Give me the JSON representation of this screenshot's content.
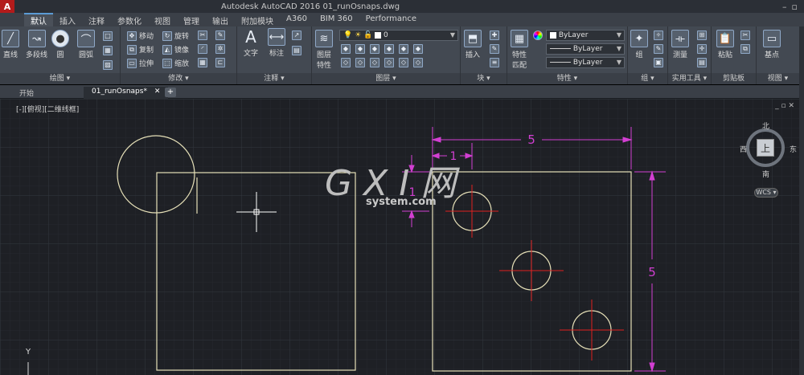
{
  "app": {
    "logo": "A",
    "title": "Autodesk AutoCAD 2016    01_runOsnaps.dwg"
  },
  "ribbon_tabs": [
    "默认",
    "插入",
    "注释",
    "参数化",
    "视图",
    "管理",
    "输出",
    "附加模块",
    "A360",
    "BIM 360",
    "Performance"
  ],
  "panels": {
    "draw": {
      "title": "绘图 ▾",
      "tools": [
        "直线",
        "多段线",
        "圆",
        "圆弧"
      ]
    },
    "modify": {
      "title": "修改 ▾",
      "rows": [
        "移动",
        "旋转",
        "复制",
        "镜像",
        "拉伸",
        "缩放"
      ]
    },
    "annotation": {
      "title": "注释 ▾",
      "tools": [
        "文字",
        "标注"
      ]
    },
    "layers": {
      "title": "图层 ▾",
      "tool": "图层\n特性",
      "tool_line1": "图层",
      "tool_line2": "特性",
      "current_layer": "0"
    },
    "block": {
      "title": "块 ▾",
      "tool": "插入"
    },
    "properties": {
      "title": "特性 ▾",
      "tool_line1": "特性",
      "tool_line2": "匹配",
      "color": "ByLayer",
      "linetype": "ByLayer",
      "lineweight": "ByLayer"
    },
    "groups": {
      "title": "组 ▾",
      "tool": "组"
    },
    "utilities": {
      "title": "实用工具 ▾",
      "tool": "测量"
    },
    "clipboard": {
      "title": "剪贴板",
      "tool": "粘贴"
    },
    "view": {
      "title": "视图 ▾",
      "tool": "基点"
    }
  },
  "doc_tabs": {
    "start": "开始",
    "current": "01_runOsnaps*",
    "add": "+"
  },
  "viewport": {
    "label": "[-][俯视][二维线框]",
    "controls": "_ ▫ ✕"
  },
  "viewcube": {
    "north": "北",
    "south": "南",
    "west": "西",
    "east": "东",
    "face": "上",
    "wcs": "WCS ▾"
  },
  "dimensions": {
    "top_width": "5",
    "right_height": "5",
    "offset_x": "1",
    "offset_y": "1"
  },
  "ucs": {
    "y": "Y"
  },
  "watermark": {
    "main": "G X I 网",
    "sub": "system.com"
  },
  "colors": {
    "dimension": "#d23fd2",
    "geometry": "#e6e0b8",
    "centermark": "#e02020",
    "grid": "#2b2e34",
    "ribbon": "#434952"
  }
}
